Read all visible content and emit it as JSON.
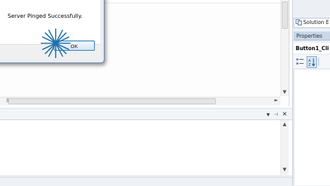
{
  "dialog": {
    "message": "Server Pinged Successfully.",
    "ok_label": "OK"
  },
  "solution_explorer": {
    "tab_label": "Solution E"
  },
  "properties": {
    "title": "Properties",
    "object_name": "Button1_Cli"
  },
  "icons": {
    "dropdown": "dropdown-arrow-icon",
    "pin": "pin-icon",
    "close": "close-icon",
    "categorized": "categorized-icon",
    "alphabetical": "alphabetical-sort-icon",
    "solution": "solution-explorer-icon",
    "click": "click-burst-icon"
  },
  "colors": {
    "accent": "#3c7fb1",
    "pane_background": "#ecf0f5",
    "properties_header": "#c9d7e8"
  }
}
